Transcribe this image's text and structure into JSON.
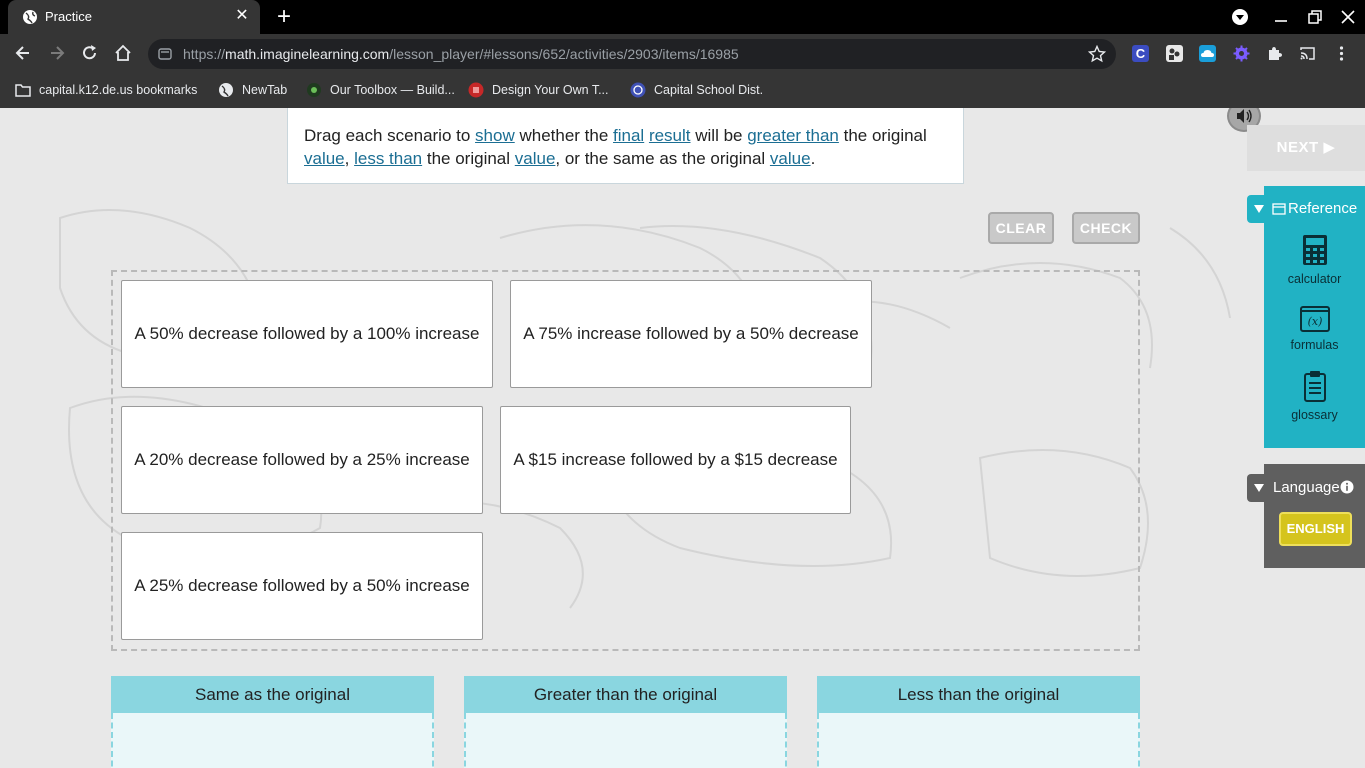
{
  "browser": {
    "tab_title": "Practice",
    "new_tab_symbol": "+",
    "close_symbol": "✕",
    "url_scheme": "https://",
    "url_host": "math.imaginelearning.com",
    "url_path": "/lesson_player/#lessons/652/activities/2903/items/16985",
    "bookmarks": [
      {
        "label": "capital.k12.de.us bookmarks",
        "icon": "folder-icon"
      },
      {
        "label": "NewTab",
        "icon": "globe-icon"
      },
      {
        "label": "Our Toolbox — Build...",
        "icon": "toolbox-icon"
      },
      {
        "label": "Design Your Own T...",
        "icon": "design-icon"
      },
      {
        "label": "Capital School Dist.",
        "icon": "school-icon"
      }
    ],
    "extension_colors": [
      "#3b4cc0",
      "#e8e8e8",
      "#1a9ed9",
      "#7a5cff"
    ]
  },
  "instruction": {
    "parts": [
      {
        "text": "Drag each scenario to ",
        "link": false
      },
      {
        "text": "show",
        "link": true
      },
      {
        "text": " whether the ",
        "link": false
      },
      {
        "text": "final",
        "link": true
      },
      {
        "text": " ",
        "link": false
      },
      {
        "text": "result",
        "link": true
      },
      {
        "text": " will be ",
        "link": false
      },
      {
        "text": "greater than",
        "link": true
      },
      {
        "text": " the original ",
        "link": false
      },
      {
        "text": "value",
        "link": true
      },
      {
        "text": ", ",
        "link": false
      },
      {
        "text": "less than",
        "link": true
      },
      {
        "text": " the original ",
        "link": false
      },
      {
        "text": "value",
        "link": true
      },
      {
        "text": ", or the same as the original ",
        "link": false
      },
      {
        "text": "value",
        "link": true
      },
      {
        "text": ".",
        "link": false
      }
    ]
  },
  "actions": {
    "clear": "CLEAR",
    "check": "CHECK",
    "next": "NEXT ▶"
  },
  "cards": [
    "A 50% decrease followed by a 100% increase",
    "A 75% increase followed by a 50% decrease",
    "A 20% decrease followed by a 25% increase",
    "A $15 increase followed by a $15 decrease",
    "A 25% decrease followed by a 50% increase"
  ],
  "bins": [
    "Same as the original",
    "Greater than the original",
    "Less than the original"
  ],
  "reference": {
    "title": "Reference",
    "items": [
      "calculator",
      "formulas",
      "glossary"
    ]
  },
  "language": {
    "title": "Language",
    "current": "ENGLISH"
  },
  "colors": {
    "accent_teal": "#21b2c4",
    "bin_header": "#8ad6e0",
    "language_button": "#d5c41d",
    "link": "#1b6e93"
  }
}
